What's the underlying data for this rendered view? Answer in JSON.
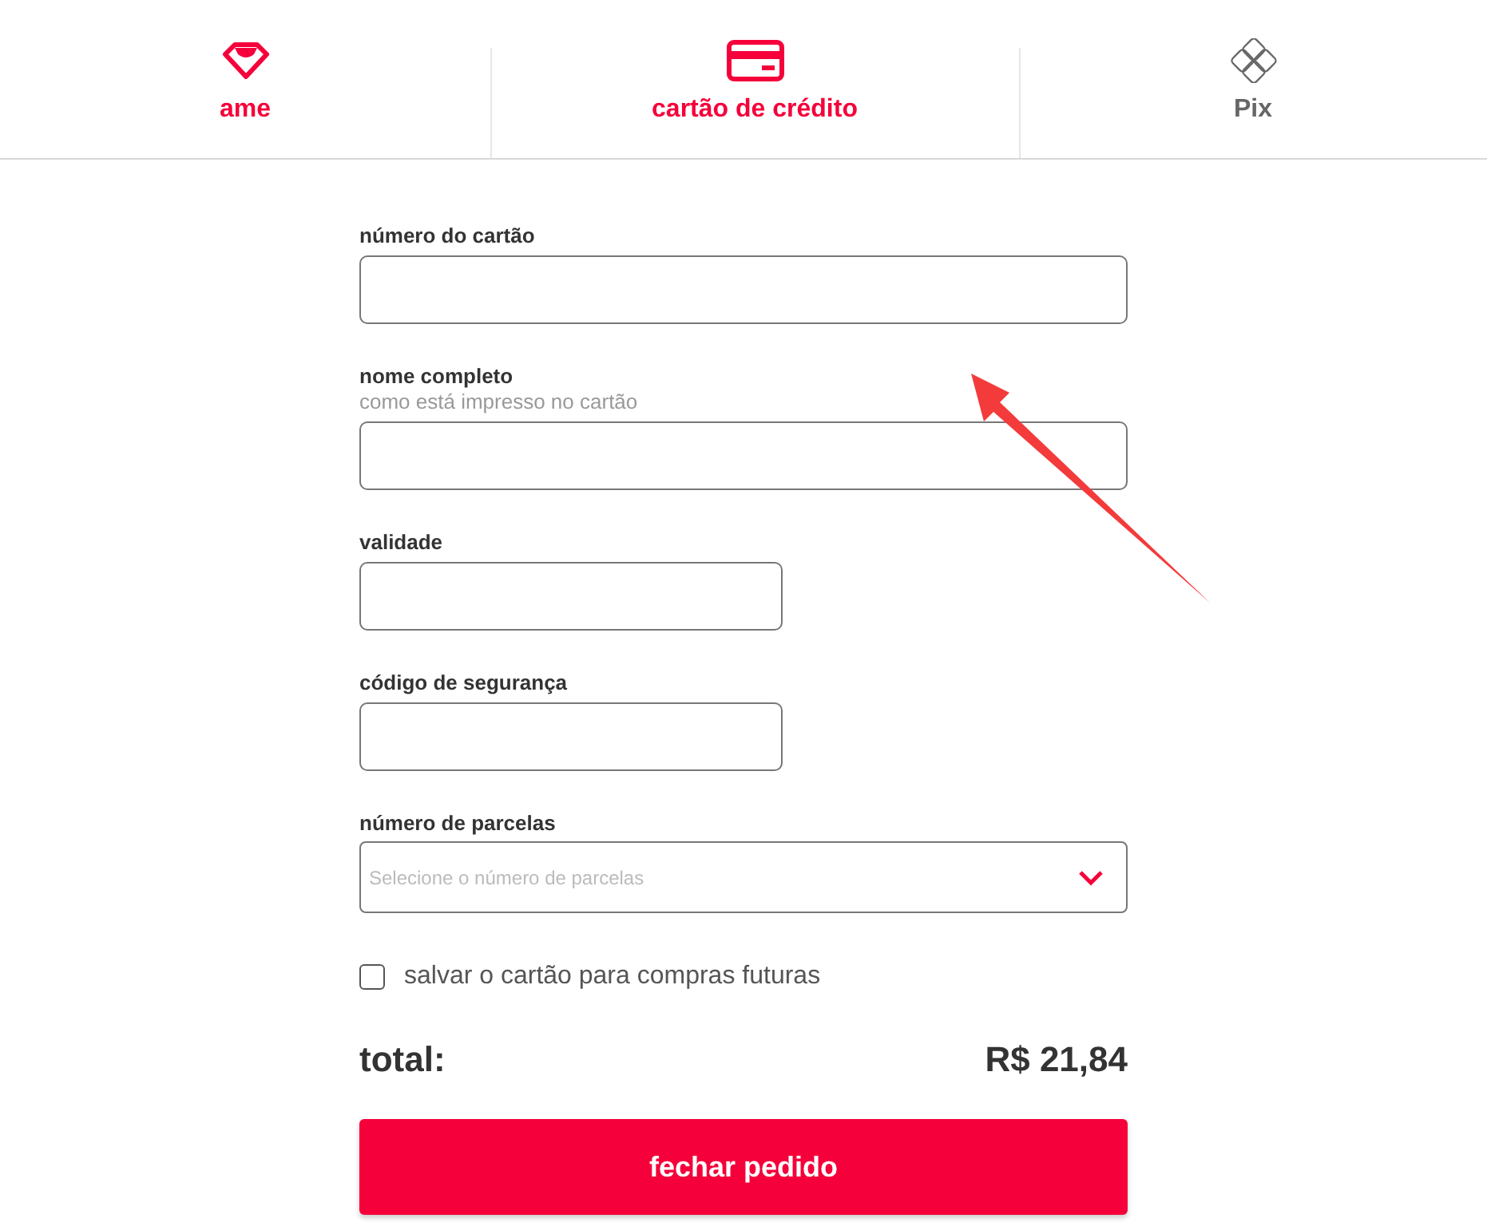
{
  "tabs": [
    {
      "label": "ame",
      "kind": "ame",
      "color": "#f5003a"
    },
    {
      "label": "cartão de crédito",
      "kind": "card",
      "color": "#f5003a"
    },
    {
      "label": "Pix",
      "kind": "pix",
      "color": "#666666"
    }
  ],
  "form": {
    "fields": [
      {
        "label": "número do cartão",
        "kind": "wide"
      },
      {
        "label": "nome completo",
        "hint": "como está impresso no cartão",
        "kind": "wide"
      },
      {
        "label": "validade",
        "kind": "narrow"
      },
      {
        "label": "código de segurança",
        "kind": "narrow"
      }
    ],
    "installments": {
      "label": "número de parcelas",
      "placeholder": "Selecione o número de parcelas"
    },
    "save_card": {
      "label": "salvar o cartão para compras futuras",
      "checked": false
    },
    "total": {
      "label": "total:",
      "value": "R$ 21,84"
    },
    "submit": "fechar pedido"
  }
}
